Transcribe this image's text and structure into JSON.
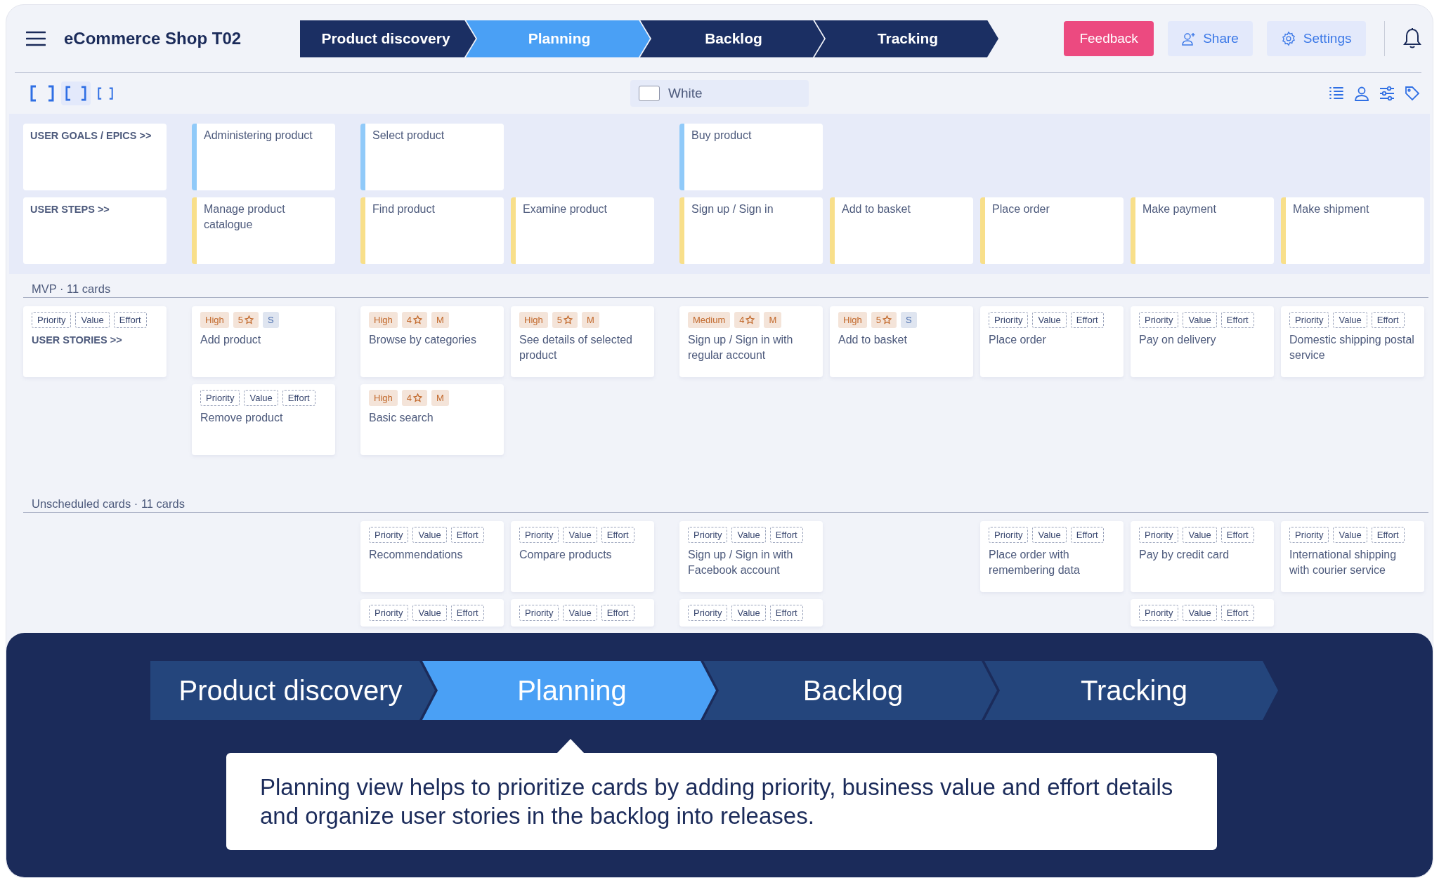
{
  "app": {
    "title": "eCommerce Shop T02"
  },
  "stages": [
    {
      "label": "Product discovery",
      "selected": false
    },
    {
      "label": "Planning",
      "selected": true
    },
    {
      "label": "Backlog",
      "selected": false
    },
    {
      "label": "Tracking",
      "selected": false
    }
  ],
  "actions": {
    "feedback": "Feedback",
    "share": "Share",
    "settings": "Settings"
  },
  "toolbar": {
    "zoom_levels": [
      {
        "selected": false
      },
      {
        "selected": true
      },
      {
        "selected": false
      }
    ],
    "card_color": {
      "label": "White",
      "checked": false
    }
  },
  "map": {
    "goals_label": "USER GOALS / EPICS >>",
    "steps_label": "USER STEPS >>",
    "stories_label": "USER STORIES >>",
    "stories_label_tags": [
      {
        "kind": "empty",
        "text": "Priority"
      },
      {
        "kind": "empty",
        "text": "Value"
      },
      {
        "kind": "empty",
        "text": "Effort"
      }
    ],
    "epics": [
      {
        "title": "Administering product",
        "steps": [
          "Manage product catalogue"
        ]
      },
      {
        "title": "Select product",
        "steps": [
          "Find product",
          "Examine product"
        ]
      },
      {
        "title": "Buy product",
        "steps": [
          "Sign up / Sign in",
          "Add to basket",
          "Place order",
          "Make payment",
          "Make shipment"
        ]
      }
    ]
  },
  "releases": [
    {
      "title": "MVP · 11 cards",
      "columns": [
        [
          {
            "title": "Add product",
            "tags": [
              {
                "kind": "priority",
                "text": "High",
                "color": "#c2692c"
              },
              {
                "kind": "value",
                "text": "5",
                "color": "#c2692c"
              },
              {
                "kind": "effort",
                "text": "S",
                "color": "#4b6fae"
              }
            ]
          },
          {
            "title": "Remove product",
            "tags": [
              {
                "kind": "empty",
                "text": "Priority"
              },
              {
                "kind": "empty",
                "text": "Value"
              },
              {
                "kind": "empty",
                "text": "Effort"
              }
            ]
          }
        ],
        [
          {
            "title": "Browse by categories",
            "tags": [
              {
                "kind": "priority",
                "text": "High",
                "color": "#c2692c"
              },
              {
                "kind": "value",
                "text": "4",
                "color": "#c2692c"
              },
              {
                "kind": "effort",
                "text": "M",
                "color": "#c2692c"
              }
            ]
          },
          {
            "title": "Basic search",
            "tags": [
              {
                "kind": "priority",
                "text": "High",
                "color": "#c2692c"
              },
              {
                "kind": "value",
                "text": "4",
                "color": "#c2692c"
              },
              {
                "kind": "effort",
                "text": "M",
                "color": "#c2692c"
              }
            ]
          }
        ],
        [
          {
            "title": "See details of selected product",
            "tags": [
              {
                "kind": "priority",
                "text": "High",
                "color": "#c2692c"
              },
              {
                "kind": "value",
                "text": "5",
                "color": "#c2692c"
              },
              {
                "kind": "effort",
                "text": "M",
                "color": "#c2692c"
              }
            ]
          }
        ],
        [
          {
            "title": "Sign up / Sign in with regular account",
            "tags": [
              {
                "kind": "priority",
                "text": "Medium",
                "color": "#c2692c"
              },
              {
                "kind": "value",
                "text": "4",
                "color": "#c2692c"
              },
              {
                "kind": "effort",
                "text": "M",
                "color": "#c2692c"
              }
            ]
          }
        ],
        [
          {
            "title": "Add to basket",
            "tags": [
              {
                "kind": "priority",
                "text": "High",
                "color": "#c2692c"
              },
              {
                "kind": "value",
                "text": "5",
                "color": "#c2692c"
              },
              {
                "kind": "effort",
                "text": "S",
                "color": "#4b6fae"
              }
            ]
          }
        ],
        [
          {
            "title": "Place order",
            "tags": [
              {
                "kind": "empty",
                "text": "Priority"
              },
              {
                "kind": "empty",
                "text": "Value"
              },
              {
                "kind": "empty",
                "text": "Effort"
              }
            ]
          }
        ],
        [
          {
            "title": "Pay on delivery",
            "tags": [
              {
                "kind": "empty",
                "text": "Priority"
              },
              {
                "kind": "empty",
                "text": "Value"
              },
              {
                "kind": "empty",
                "text": "Effort"
              }
            ]
          }
        ],
        [
          {
            "title": "Domestic shipping postal service",
            "tags": [
              {
                "kind": "empty",
                "text": "Priority"
              },
              {
                "kind": "empty",
                "text": "Value"
              },
              {
                "kind": "empty",
                "text": "Effort"
              }
            ]
          }
        ]
      ]
    },
    {
      "title": "Unscheduled cards · 11 cards",
      "columns": [
        [],
        [
          {
            "title": "Recommendations",
            "tags": [
              {
                "kind": "empty",
                "text": "Priority"
              },
              {
                "kind": "empty",
                "text": "Value"
              },
              {
                "kind": "empty",
                "text": "Effort"
              }
            ]
          },
          {
            "tags": [
              {
                "kind": "empty",
                "text": "Priority"
              },
              {
                "kind": "empty",
                "text": "Value"
              },
              {
                "kind": "empty",
                "text": "Effort"
              }
            ]
          }
        ],
        [
          {
            "title": "Compare products",
            "tags": [
              {
                "kind": "empty",
                "text": "Priority"
              },
              {
                "kind": "empty",
                "text": "Value"
              },
              {
                "kind": "empty",
                "text": "Effort"
              }
            ]
          },
          {
            "tags": [
              {
                "kind": "empty",
                "text": "Priority"
              },
              {
                "kind": "empty",
                "text": "Value"
              },
              {
                "kind": "empty",
                "text": "Effort"
              }
            ]
          }
        ],
        [
          {
            "title": "Sign up / Sign in with Facebook account",
            "tags": [
              {
                "kind": "empty",
                "text": "Priority"
              },
              {
                "kind": "empty",
                "text": "Value"
              },
              {
                "kind": "empty",
                "text": "Effort"
              }
            ]
          },
          {
            "tags": [
              {
                "kind": "empty",
                "text": "Priority"
              },
              {
                "kind": "empty",
                "text": "Value"
              },
              {
                "kind": "empty",
                "text": "Effort"
              }
            ]
          }
        ],
        [],
        [
          {
            "title": "Place order with remembering data",
            "tags": [
              {
                "kind": "empty",
                "text": "Priority"
              },
              {
                "kind": "empty",
                "text": "Value"
              },
              {
                "kind": "empty",
                "text": "Effort"
              }
            ]
          }
        ],
        [
          {
            "title": "Pay by credit card",
            "tags": [
              {
                "kind": "empty",
                "text": "Priority"
              },
              {
                "kind": "empty",
                "text": "Value"
              },
              {
                "kind": "empty",
                "text": "Effort"
              }
            ]
          },
          {
            "tags": [
              {
                "kind": "empty",
                "text": "Priority"
              },
              {
                "kind": "empty",
                "text": "Value"
              },
              {
                "kind": "empty",
                "text": "Effort"
              }
            ]
          }
        ],
        [
          {
            "title": "International shipping with courier service",
            "tags": [
              {
                "kind": "empty",
                "text": "Priority"
              },
              {
                "kind": "empty",
                "text": "Value"
              },
              {
                "kind": "empty",
                "text": "Effort"
              }
            ]
          }
        ]
      ]
    }
  ],
  "overlay": {
    "stages": [
      {
        "label": "Product discovery",
        "selected": false
      },
      {
        "label": "Planning",
        "selected": true
      },
      {
        "label": "Backlog",
        "selected": false
      },
      {
        "label": "Tracking",
        "selected": false
      }
    ],
    "description": "Planning view helps to prioritize cards by adding priority, business value and effort details and organize user stories in the backlog into releases."
  }
}
